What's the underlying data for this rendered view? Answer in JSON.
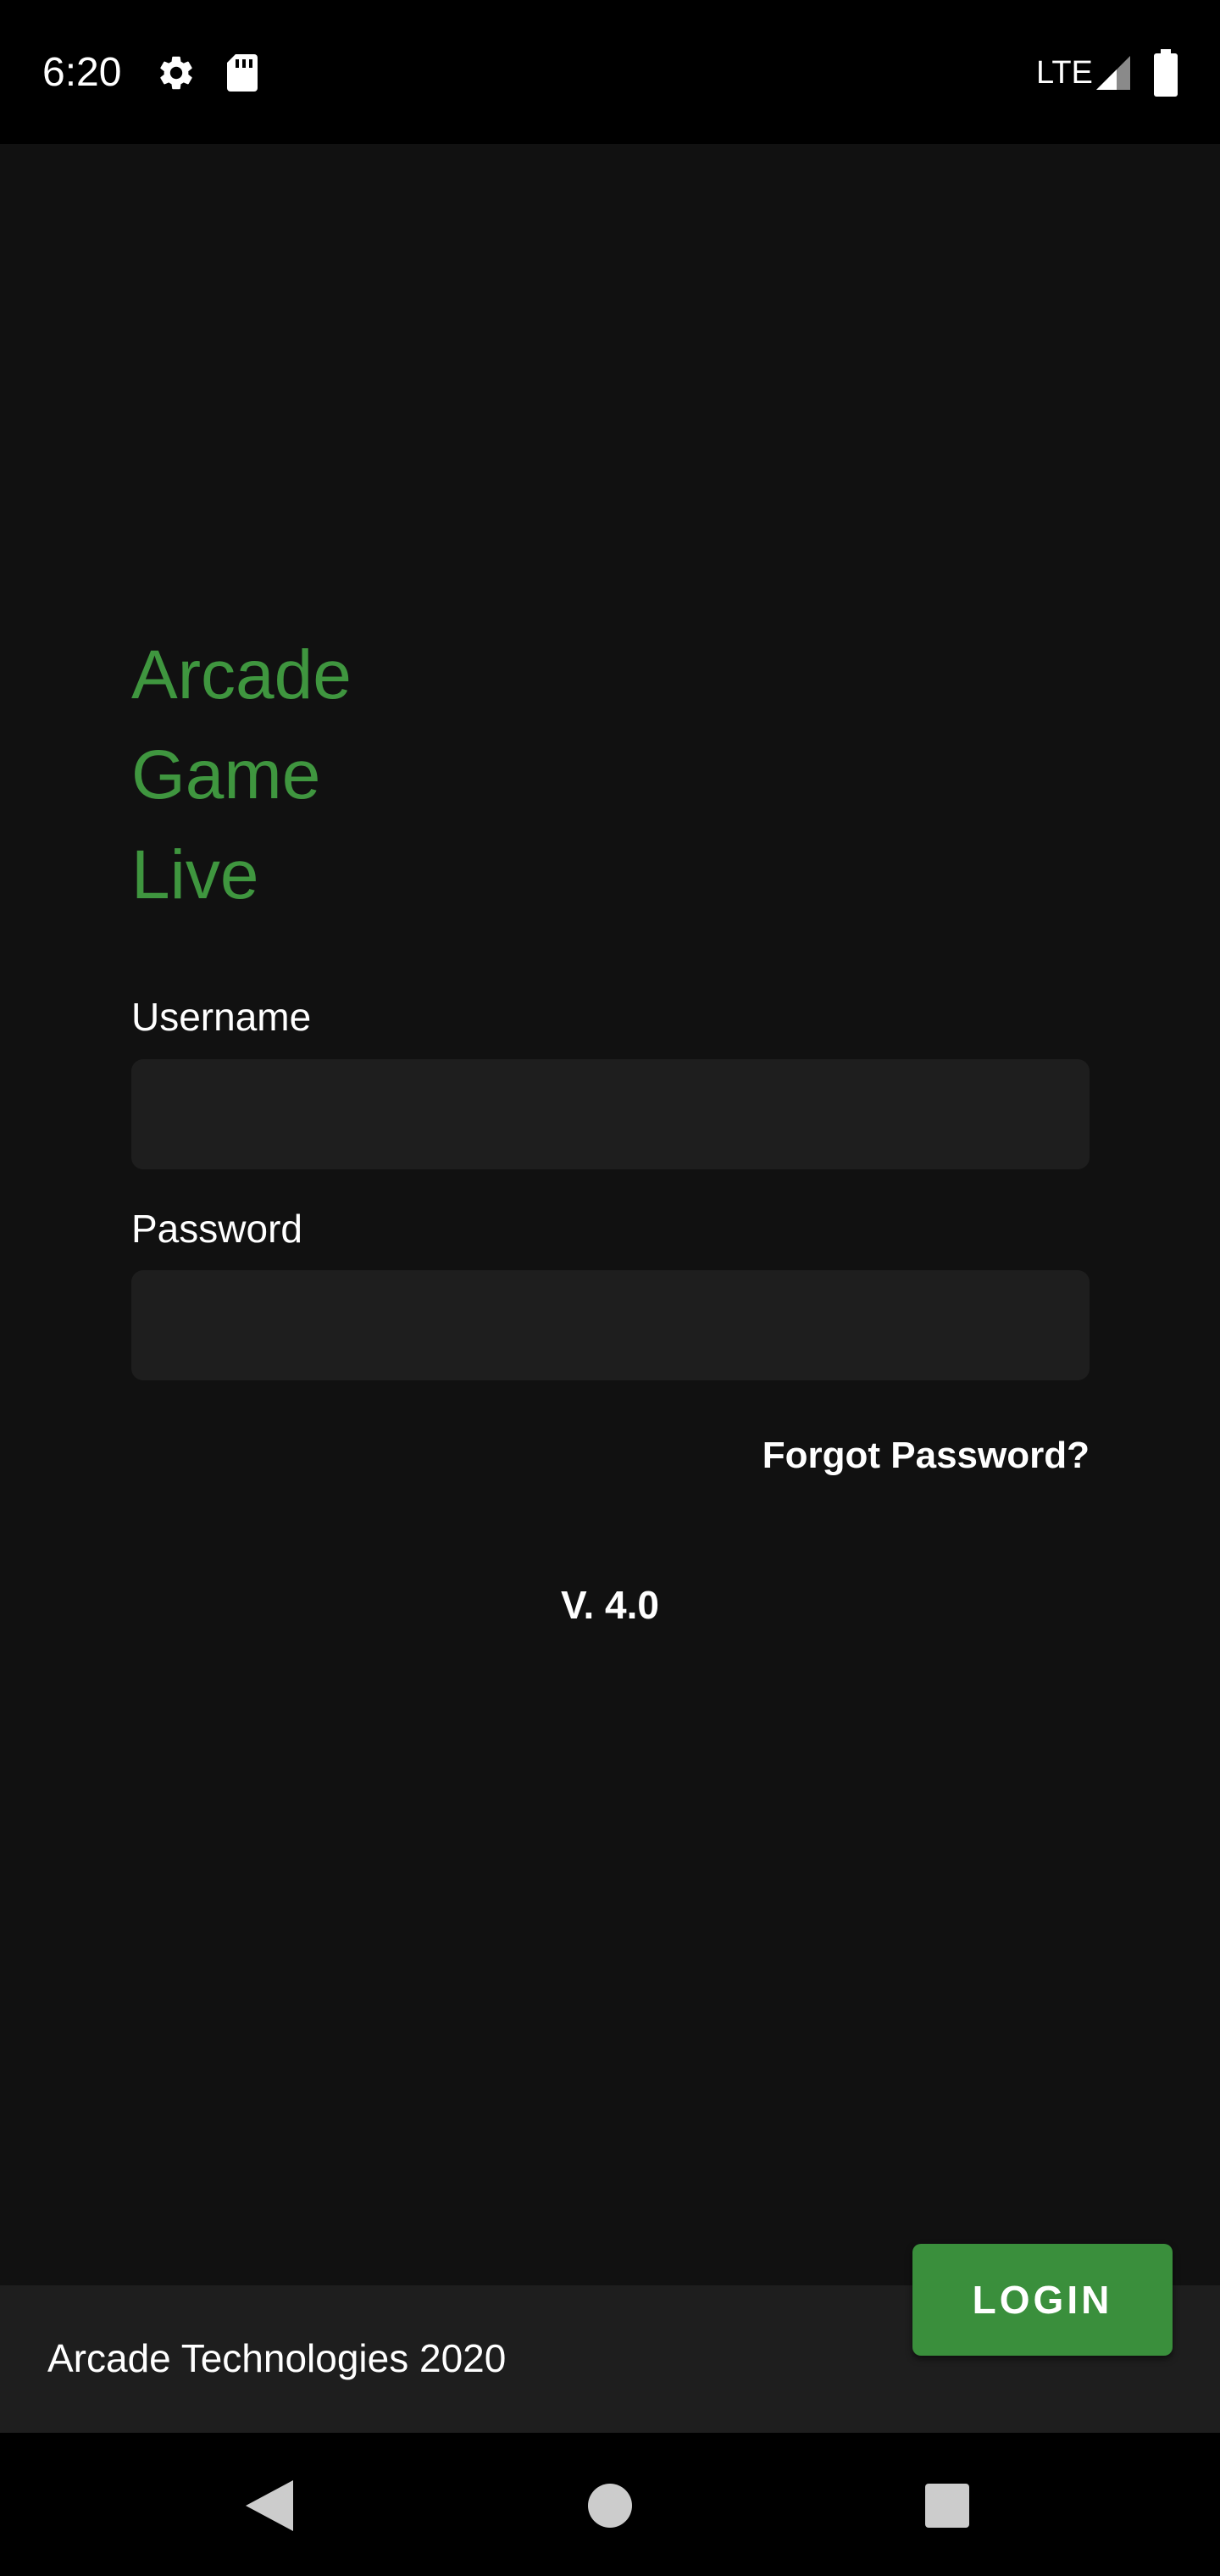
{
  "status_bar": {
    "time": "6:20",
    "network": "LTE",
    "icons": [
      "gear-icon",
      "sd-card-icon",
      "signal-icon",
      "battery-icon"
    ]
  },
  "app": {
    "title_lines": [
      "Arcade",
      "Game",
      "Live"
    ],
    "accent_color": "#3f963f"
  },
  "form": {
    "username_label": "Username",
    "username_value": "",
    "password_label": "Password",
    "password_value": "",
    "forgot_password": "Forgot Password?"
  },
  "version": "V. 4.0",
  "footer": {
    "text": "Arcade Technologies 2020"
  },
  "login_button": {
    "label": "LOGIN",
    "color": "#3a8f3c"
  },
  "nav_bar": {
    "icons": [
      "back-icon",
      "home-icon",
      "recents-icon"
    ]
  }
}
